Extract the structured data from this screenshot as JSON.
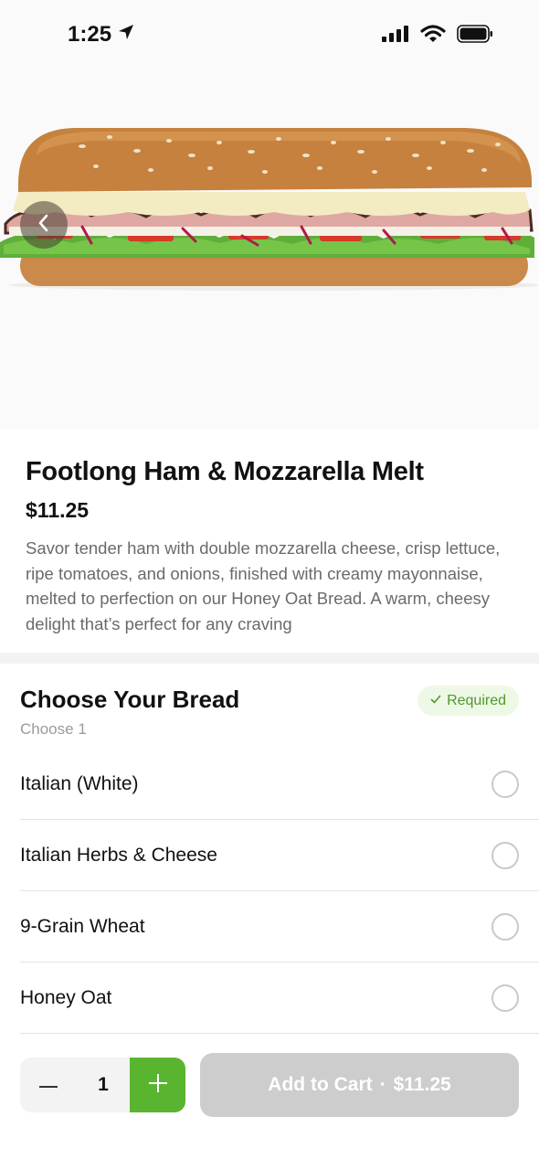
{
  "status": {
    "time": "1:25",
    "icons": [
      "location-arrow-icon",
      "cellular-signal-icon",
      "wifi-icon",
      "battery-icon"
    ]
  },
  "hero": {
    "image": "footlong-sandwich-photo",
    "back_icon": "chevron-left-icon"
  },
  "product": {
    "title": "Footlong Ham & Mozzarella Melt",
    "price": "$11.25",
    "description": "Savor tender ham with double mozzarella cheese, crisp lettuce, ripe tomatoes, and onions, finished with creamy mayonnaise, melted to perfection on our Honey Oat Bread. A warm, cheesy delight that’s perfect for any craving"
  },
  "bread": {
    "title": "Choose Your Bread",
    "subtitle": "Choose 1",
    "badge": "Required",
    "badge_icon": "checkmark-icon",
    "options": [
      {
        "label": "Italian (White)",
        "selected": false
      },
      {
        "label": "Italian Herbs & Cheese",
        "selected": false
      },
      {
        "label": "9-Grain Wheat",
        "selected": false
      },
      {
        "label": "Honey Oat",
        "selected": false
      }
    ]
  },
  "cart": {
    "quantity": "1",
    "button_label": "Add to Cart",
    "separator": "·",
    "button_price": "$11.25"
  },
  "colors": {
    "accent_green": "#59b52f",
    "badge_bg": "#eef8e6",
    "badge_text": "#4e9a2a",
    "disabled_button": "#cdcdcd"
  }
}
